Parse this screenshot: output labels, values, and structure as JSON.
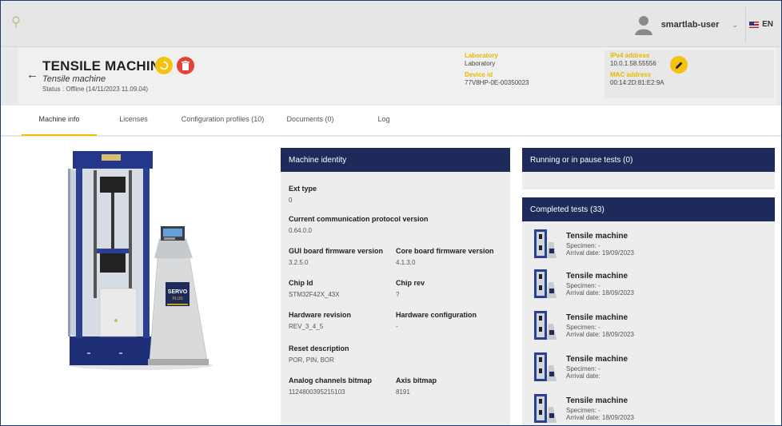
{
  "topbar": {
    "username": "smartlab-user",
    "language": "EN",
    "icons": {
      "logo": "pin-icon",
      "avatar": "user-avatar-icon",
      "dropdown": "chevron-down-icon",
      "flag": "uk-flag-icon"
    }
  },
  "header": {
    "title": "TENSILE MACHINE",
    "subtitle": "Tensile machine",
    "status": "Status : Offline (14/11/2023 11.09.04)",
    "laboratory_label": "Laboratory",
    "laboratory_value": "Laboratory",
    "device_id_label": "Device id",
    "device_id_value": "77V8HP-0E-00350023",
    "ipv4_label": "IPv4 address",
    "ipv4_value": "10.0.1.58.55556",
    "mac_label": "MAC address",
    "mac_value": "00:14:2D:81:E2:9A",
    "colors": {
      "accent": "#f3c212",
      "danger": "#e3443a"
    }
  },
  "tabs": [
    {
      "label": "Machine info",
      "active": true
    },
    {
      "label": "Licenses",
      "active": false
    },
    {
      "label": "Configuration profiles (10)",
      "active": false
    },
    {
      "label": "Documents (0)",
      "active": false
    },
    {
      "label": "Log",
      "active": false
    }
  ],
  "identity": {
    "heading": "Machine identity",
    "fields": {
      "ext_type_label": "Ext type",
      "ext_type_value": "0",
      "protocol_label": "Current communication protocol version",
      "protocol_value": "0.64.0.0",
      "gui_fw_label": "GUI board firmware version",
      "gui_fw_value": "3.2.5.0",
      "core_fw_label": "Core board firmware version",
      "core_fw_value": "4.1.3.0",
      "chip_id_label": "Chip Id",
      "chip_id_value": "STM32F42X_43X",
      "chip_rev_label": "Chip rev",
      "chip_rev_value": "?",
      "hw_rev_label": "Hardware revision",
      "hw_rev_value": "REV_3_4_5",
      "hw_conf_label": "Hardware configuration",
      "hw_conf_value": "-",
      "reset_label": "Reset description",
      "reset_value": "POR, PIN, BOR",
      "analog_label": "Analog channels bitmap",
      "analog_value": "1124800395215103",
      "axis_label": "Axis bitmap",
      "axis_value": "8191"
    }
  },
  "running": {
    "heading": "Running or in pause tests (0)"
  },
  "completed": {
    "heading": "Completed tests (33)",
    "items": [
      {
        "title": "Tensile machine",
        "specimen": "Specimen: -",
        "date": "Arrival date: 19/09/2023"
      },
      {
        "title": "Tensile machine",
        "specimen": "Specimen: -",
        "date": "Arrival date: 18/09/2023"
      },
      {
        "title": "Tensile machine",
        "specimen": "Specimen: -",
        "date": "Arrival date: 18/09/2023"
      },
      {
        "title": "Tensile machine",
        "specimen": "Specimen: -",
        "date": "Arrival date:"
      },
      {
        "title": "Tensile machine",
        "specimen": "Specimen: -",
        "date": "Arrival date: 18/09/2023"
      }
    ]
  },
  "machine_brand_text": "SERVO PLUS"
}
